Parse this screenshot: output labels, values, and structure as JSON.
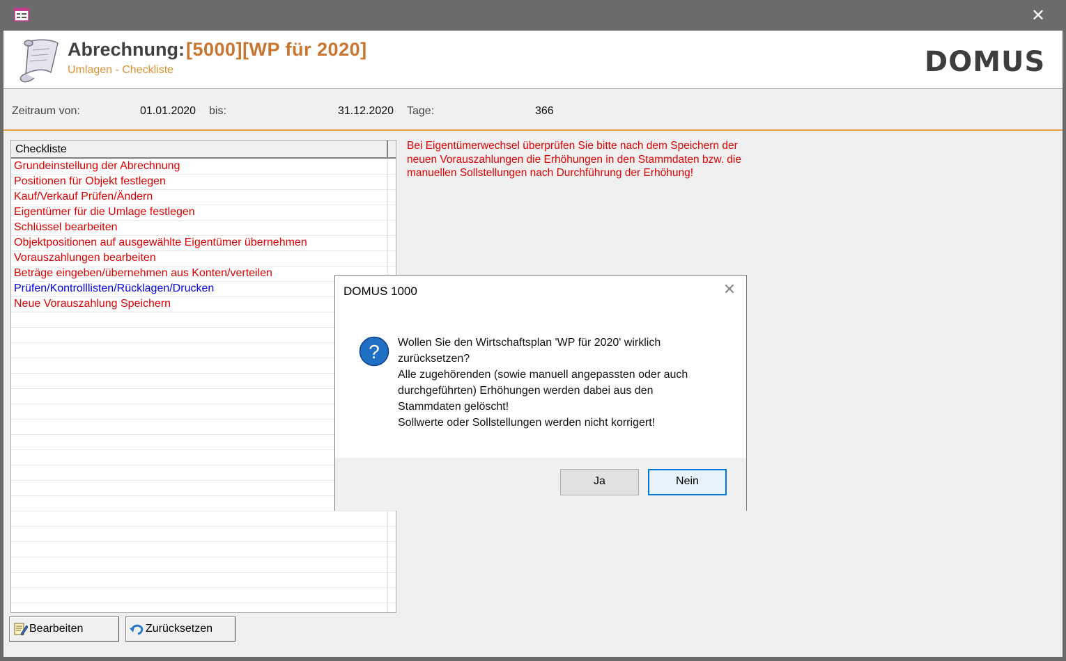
{
  "window": {
    "close_glyph": "✕",
    "app_icon": "form-icon"
  },
  "header": {
    "title": "Abrechnung:",
    "code": "[5000][WP für 2020]",
    "subtitle": "Umlagen - Checkliste",
    "logo": "DOMUS",
    "icon": "scroll-icon"
  },
  "period": {
    "from_label": "Zeitraum von:",
    "from_value": "01.01.2020",
    "to_label": "bis:",
    "to_value": "31.12.2020",
    "days_label": "Tage:",
    "days_value": "366"
  },
  "checklist": {
    "header": "Checkliste",
    "items": [
      {
        "label": "Grundeinstellung der Abrechnung",
        "color": "#e00000"
      },
      {
        "label": "Positionen für Objekt festlegen",
        "color": "#e00000"
      },
      {
        "label": "Kauf/Verkauf Prüfen/Ändern",
        "color": "#e00000"
      },
      {
        "label": "Eigentümer für die Umlage festlegen",
        "color": "#e00000"
      },
      {
        "label": "Schlüssel bearbeiten",
        "color": "#e00000"
      },
      {
        "label": "Objektpositionen auf ausgewählte Eigentümer übernehmen",
        "color": "#e00000"
      },
      {
        "label": "Vorauszahlungen bearbeiten",
        "color": "#e00000"
      },
      {
        "label": "Beträge eingeben/übernehmen aus Konten/verteilen",
        "color": "#e00000"
      },
      {
        "label": "Prüfen/Kontrolllisten/Rücklagen/Drucken",
        "color": "#0000ee"
      },
      {
        "label": "Neue Vorauszahlung Speichern",
        "color": "#e00000"
      }
    ]
  },
  "note": {
    "line1": "Bei Eigentümerwechsel überprüfen Sie bitte nach dem Speichern der",
    "line2": "neuen Vorauszahlungen die Erhöhungen in den Stammdaten bzw. die",
    "line3": "manuellen Sollstellungen nach Durchführung der Erhöhung!"
  },
  "buttons": {
    "edit_label": "Bearbeiten",
    "reset_label": "Zurücksetzen"
  },
  "dialog": {
    "title": "DOMUS 1000",
    "close_glyph": "✕",
    "icon": "question-icon",
    "lines": [
      "Wollen Sie den Wirtschaftsplan 'WP für 2020' wirklich",
      "zurücksetzen?",
      "Alle zugehörenden (sowie manuell angepassten oder auch",
      "durchgeführten) Erhöhungen werden dabei aus den",
      "Stammdaten gelöscht!",
      "Sollwerte oder Sollstellungen werden nicht korrigert!"
    ],
    "yes_label": "Ja",
    "no_label": "Nein"
  }
}
